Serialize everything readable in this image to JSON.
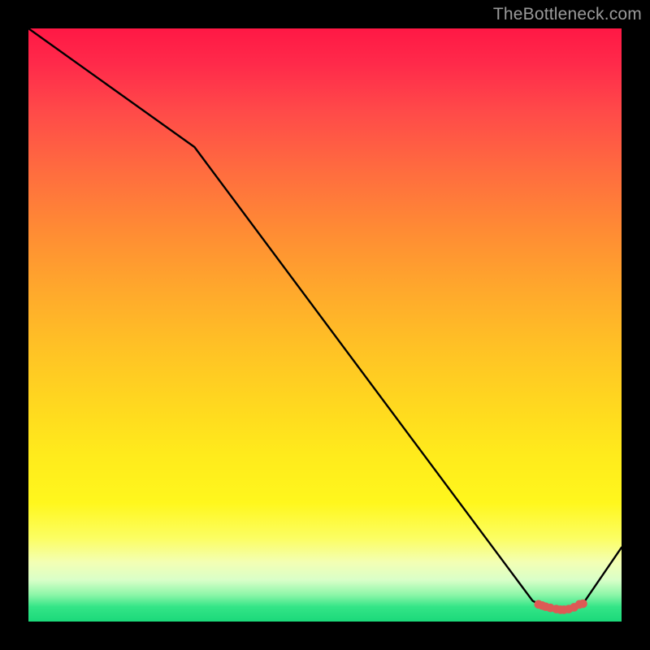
{
  "watermark": "TheBottleneck.com",
  "chart_data": {
    "type": "line",
    "title": "",
    "xlabel": "",
    "ylabel": "",
    "xlim": [
      0,
      100
    ],
    "ylim": [
      0,
      100
    ],
    "x": [
      0,
      28,
      85,
      86.5,
      88,
      89.5,
      91,
      92,
      93.5,
      100
    ],
    "values": [
      100,
      80,
      3.5,
      2.7,
      2.3,
      2.0,
      2.0,
      2.3,
      3.0,
      12.5
    ],
    "markers": {
      "x": [
        86.0,
        86.6,
        87.2,
        88.0,
        89.0,
        89.7,
        90.3,
        91.1,
        92.0,
        92.9,
        93.5
      ],
      "y": [
        2.9,
        2.7,
        2.5,
        2.3,
        2.1,
        2.0,
        2.0,
        2.1,
        2.4,
        2.9,
        3.0
      ],
      "color": "#dd5a55",
      "size": 5.3
    },
    "background_gradient": {
      "top": "#ff1845",
      "bottom": "#1bd97a"
    }
  }
}
